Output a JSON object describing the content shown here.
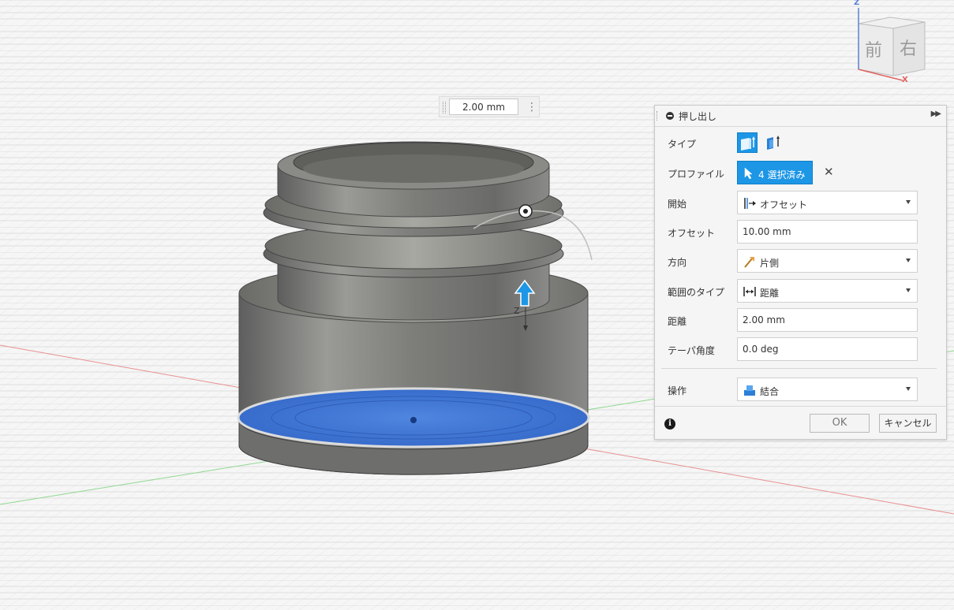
{
  "viewport": {
    "floating_value": "2.00 mm",
    "manipulator_label": "Z"
  },
  "viewcube": {
    "face_front": "前",
    "face_right": "右",
    "axis_z": "Z",
    "axis_x": "X"
  },
  "dialog": {
    "title": "押し出し",
    "rows": {
      "type": {
        "label": "タイプ"
      },
      "profile": {
        "label": "プロファイル",
        "value": "4 選択済み"
      },
      "start": {
        "label": "開始",
        "value": "オフセット"
      },
      "offset": {
        "label": "オフセット",
        "value": "10.00 mm"
      },
      "direction": {
        "label": "方向",
        "value": "片側"
      },
      "extent_type": {
        "label": "範囲のタイプ",
        "value": "距離"
      },
      "distance": {
        "label": "距離",
        "value": "2.00 mm"
      },
      "taper": {
        "label": "テーパ角度",
        "value": "0.0 deg"
      },
      "operation": {
        "label": "操作",
        "value": "結合"
      }
    },
    "ok_label": "OK",
    "cancel_label": "キャンセル"
  },
  "colors": {
    "accent": "#1d96e6",
    "selected_face": "#3a73d0",
    "body_gray": "#7a7a7a"
  }
}
